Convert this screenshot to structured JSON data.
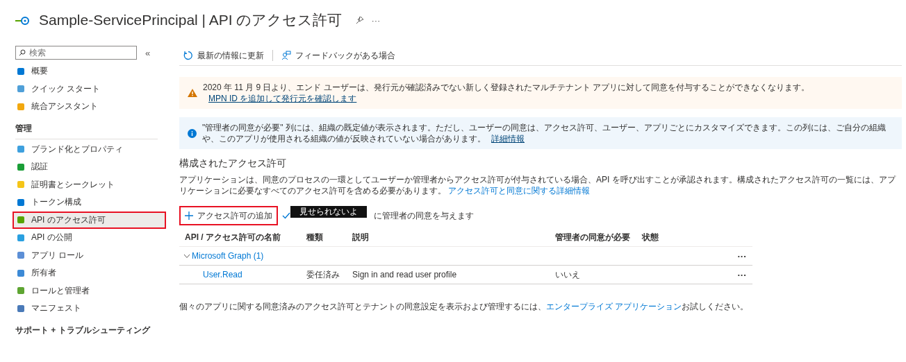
{
  "header": {
    "title": "Sample-ServicePrincipal | API のアクセス許可",
    "more": "···"
  },
  "sidebar": {
    "search": {
      "placeholder": "検索"
    },
    "collapse": "«",
    "sections": [
      {
        "items": [
          {
            "label": "概要",
            "selected": false,
            "highlighted": false
          },
          {
            "label": "クイック スタート",
            "selected": false,
            "highlighted": false
          },
          {
            "label": "統合アシスタント",
            "selected": false,
            "highlighted": false
          }
        ]
      },
      {
        "heading": "管理",
        "items": [
          {
            "label": "ブランド化とプロパティ",
            "selected": false,
            "highlighted": false
          },
          {
            "label": "認証",
            "selected": false,
            "highlighted": false
          },
          {
            "label": "証明書とシークレット",
            "selected": false,
            "highlighted": false
          },
          {
            "label": "トークン構成",
            "selected": false,
            "highlighted": false
          },
          {
            "label": "API のアクセス許可",
            "selected": true,
            "highlighted": true
          },
          {
            "label": "API の公開",
            "selected": false,
            "highlighted": false
          },
          {
            "label": "アプリ ロール",
            "selected": false,
            "highlighted": false
          },
          {
            "label": "所有者",
            "selected": false,
            "highlighted": false
          },
          {
            "label": "ロールと管理者",
            "selected": false,
            "highlighted": false
          },
          {
            "label": "マニフェスト",
            "selected": false,
            "highlighted": false
          }
        ]
      },
      {
        "heading": "サポート + トラブルシューティング"
      }
    ]
  },
  "toolbar": [
    {
      "kind": "refresh",
      "label": "最新の情報に更新"
    },
    {
      "kind": "feedback",
      "label": "フィードバックがある場合"
    }
  ],
  "banners": [
    {
      "kind": "warning",
      "text": "2020 年 11 月 9 日より、エンド ユーザーは、発行元が確認済みでない新しく登録されたマルチテナント アプリに対して同意を付与することができなくなります。",
      "link": "MPN ID を追加して発行元を確認します"
    },
    {
      "kind": "info",
      "text": "\"管理者の同意が必要\" 列には、組織の既定値が表示されます。ただし、ユーザーの同意は、アクセス許可、ユーザー、アプリごとにカスタマイズできます。この列には、ご自分の組織や、このアプリが使用される組織の値が反映されていない場合があります。",
      "link": "詳細情報"
    }
  ],
  "section": {
    "title": "構成されたアクセス許可",
    "description": "アプリケーションは、同意のプロセスの一環としてユーザーか管理者からアクセス許可が付与されている場合、API を呼び出すことが承認されます。構成されたアクセス許可の一覧には、アプリケーションに必要なすべてのアクセス許可を含める必要があります。",
    "link": "アクセス許可と同意に関する詳細情報"
  },
  "commands": {
    "add": {
      "label": "アクセス許可の追加",
      "highlighted": true
    },
    "grant": {
      "label": "に管理者の同意を与えます"
    },
    "redaction": "見せられないよ"
  },
  "table": {
    "columns": [
      "API / アクセス許可の名前",
      "種類",
      "説明",
      "管理者の同意が必要",
      "状態"
    ],
    "groups": [
      {
        "name": "Microsoft Graph (1)",
        "expanded": true,
        "more": "···",
        "rows": [
          {
            "name": "User.Read",
            "type": "委任済み",
            "description": "Sign in and read user profile",
            "admin_consent": "いいえ",
            "more": "···"
          }
        ]
      }
    ]
  },
  "footer": {
    "text": "個々のアプリに関する同意済みのアクセス許可とテナントの同意設定を表示および管理するには、",
    "link": "エンタープライズ アプリケーション",
    "suffix": "お試しください。"
  }
}
